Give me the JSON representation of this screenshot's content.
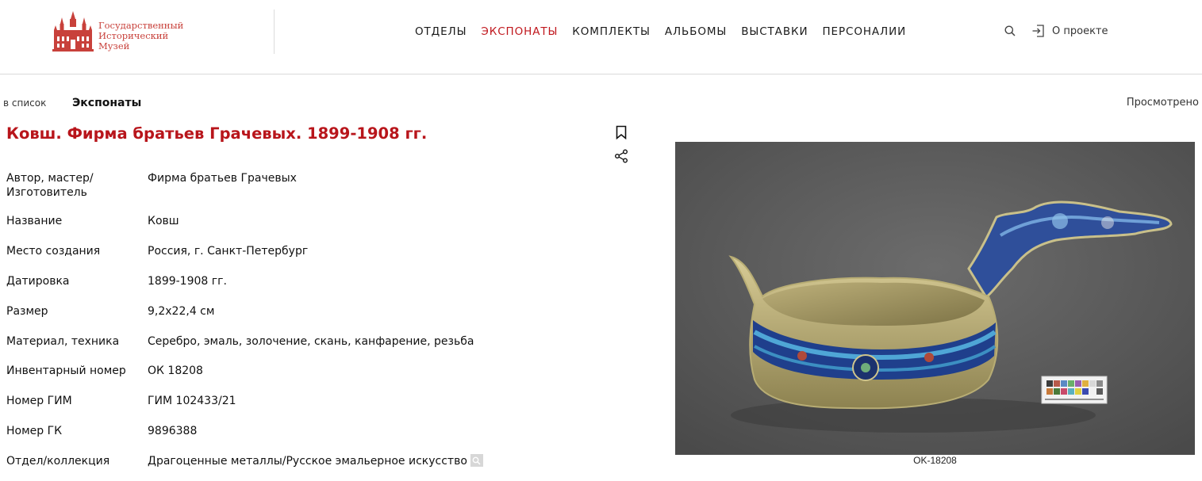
{
  "header": {
    "logo_text": [
      "Государственный",
      "Исторический",
      "Музей"
    ],
    "nav": [
      {
        "label": "ОТДЕЛЫ",
        "active": false
      },
      {
        "label": "ЭКСПОНАТЫ",
        "active": true
      },
      {
        "label": "КОМПЛЕКТЫ",
        "active": false
      },
      {
        "label": "АЛЬБОМЫ",
        "active": false
      },
      {
        "label": "ВЫСТАВКИ",
        "active": false
      },
      {
        "label": "ПЕРСОНАЛИИ",
        "active": false
      }
    ],
    "about_label": "О проекте",
    "search_icon": "search-icon",
    "login_icon": "login-icon"
  },
  "subbar": {
    "back_label": "в список",
    "section_label": "Экспонаты",
    "viewed_label": "Просмотрено"
  },
  "item": {
    "title": "Ковш. Фирма братьев Грачевых. 1899-1908 гг.",
    "attributes": [
      {
        "label": "Автор, мастер/ Изготовитель",
        "value": "Фирма братьев Грачевых"
      },
      {
        "label": "Название",
        "value": "Ковш"
      },
      {
        "label": "Место создания",
        "value": "Россия, г. Санкт-Петербург"
      },
      {
        "label": "Датировка",
        "value": "1899-1908 гг."
      },
      {
        "label": "Размер",
        "value": "9,2х22,4 см"
      },
      {
        "label": "Материал, техника",
        "value": "Серебро, эмаль, золочение, скань, канфарение, резьба"
      },
      {
        "label": "Инвентарный номер",
        "value": "ОК 18208"
      },
      {
        "label": "Номер ГИМ",
        "value": "ГИМ 102433/21"
      },
      {
        "label": "Номер ГК",
        "value": "9896388"
      },
      {
        "label": "Отдел/коллекция",
        "value": "Драгоценные металлы/Русское эмальерное искусство"
      }
    ],
    "image_caption": "OK-18208"
  },
  "colors": {
    "accent": "#b8151b",
    "logo": "#c8413b",
    "photo_bg": "#5e5e5e"
  }
}
